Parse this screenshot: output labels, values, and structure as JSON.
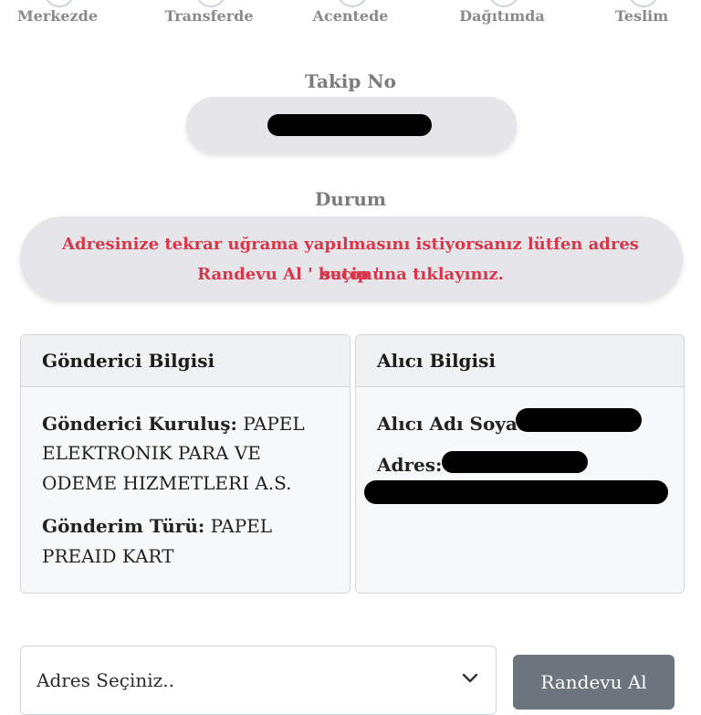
{
  "steps": [
    {
      "label": "Merkezde"
    },
    {
      "label": "Transferde"
    },
    {
      "label": "Acentede"
    },
    {
      "label": "Dağıtımda"
    },
    {
      "label": "Teslim"
    }
  ],
  "tracking": {
    "title": "Takip No",
    "value": ""
  },
  "status": {
    "title": "Durum",
    "message_line1": "Adresinize tekrar uğrama yapılmasını istiyorsanız lütfen adres seçip '",
    "message_line2": "Randevu Al ' butonuna tıklayınız."
  },
  "sender": {
    "header": "Gönderici Bilgisi",
    "org_label": "Gönderici Kuruluş:",
    "org_value_line1": "PAPEL",
    "org_value_line2": "ELEKTRONIK PARA VE",
    "org_value_line3": "ODEME HIZMETLERI A.S.",
    "type_label": "Gönderim Türü:",
    "type_value_line1": "PAPEL",
    "type_value_line2": "PREAID KART"
  },
  "receiver": {
    "header": "Alıcı Bilgisi",
    "name_label": "Alıcı Adı Soyadı:",
    "address_label": "Adres:"
  },
  "appointment": {
    "select_placeholder": "Adres Seçiniz..",
    "button_label": "Randevu Al"
  },
  "colors": {
    "status_text": "#d9364a",
    "button_bg": "#6c757d"
  }
}
